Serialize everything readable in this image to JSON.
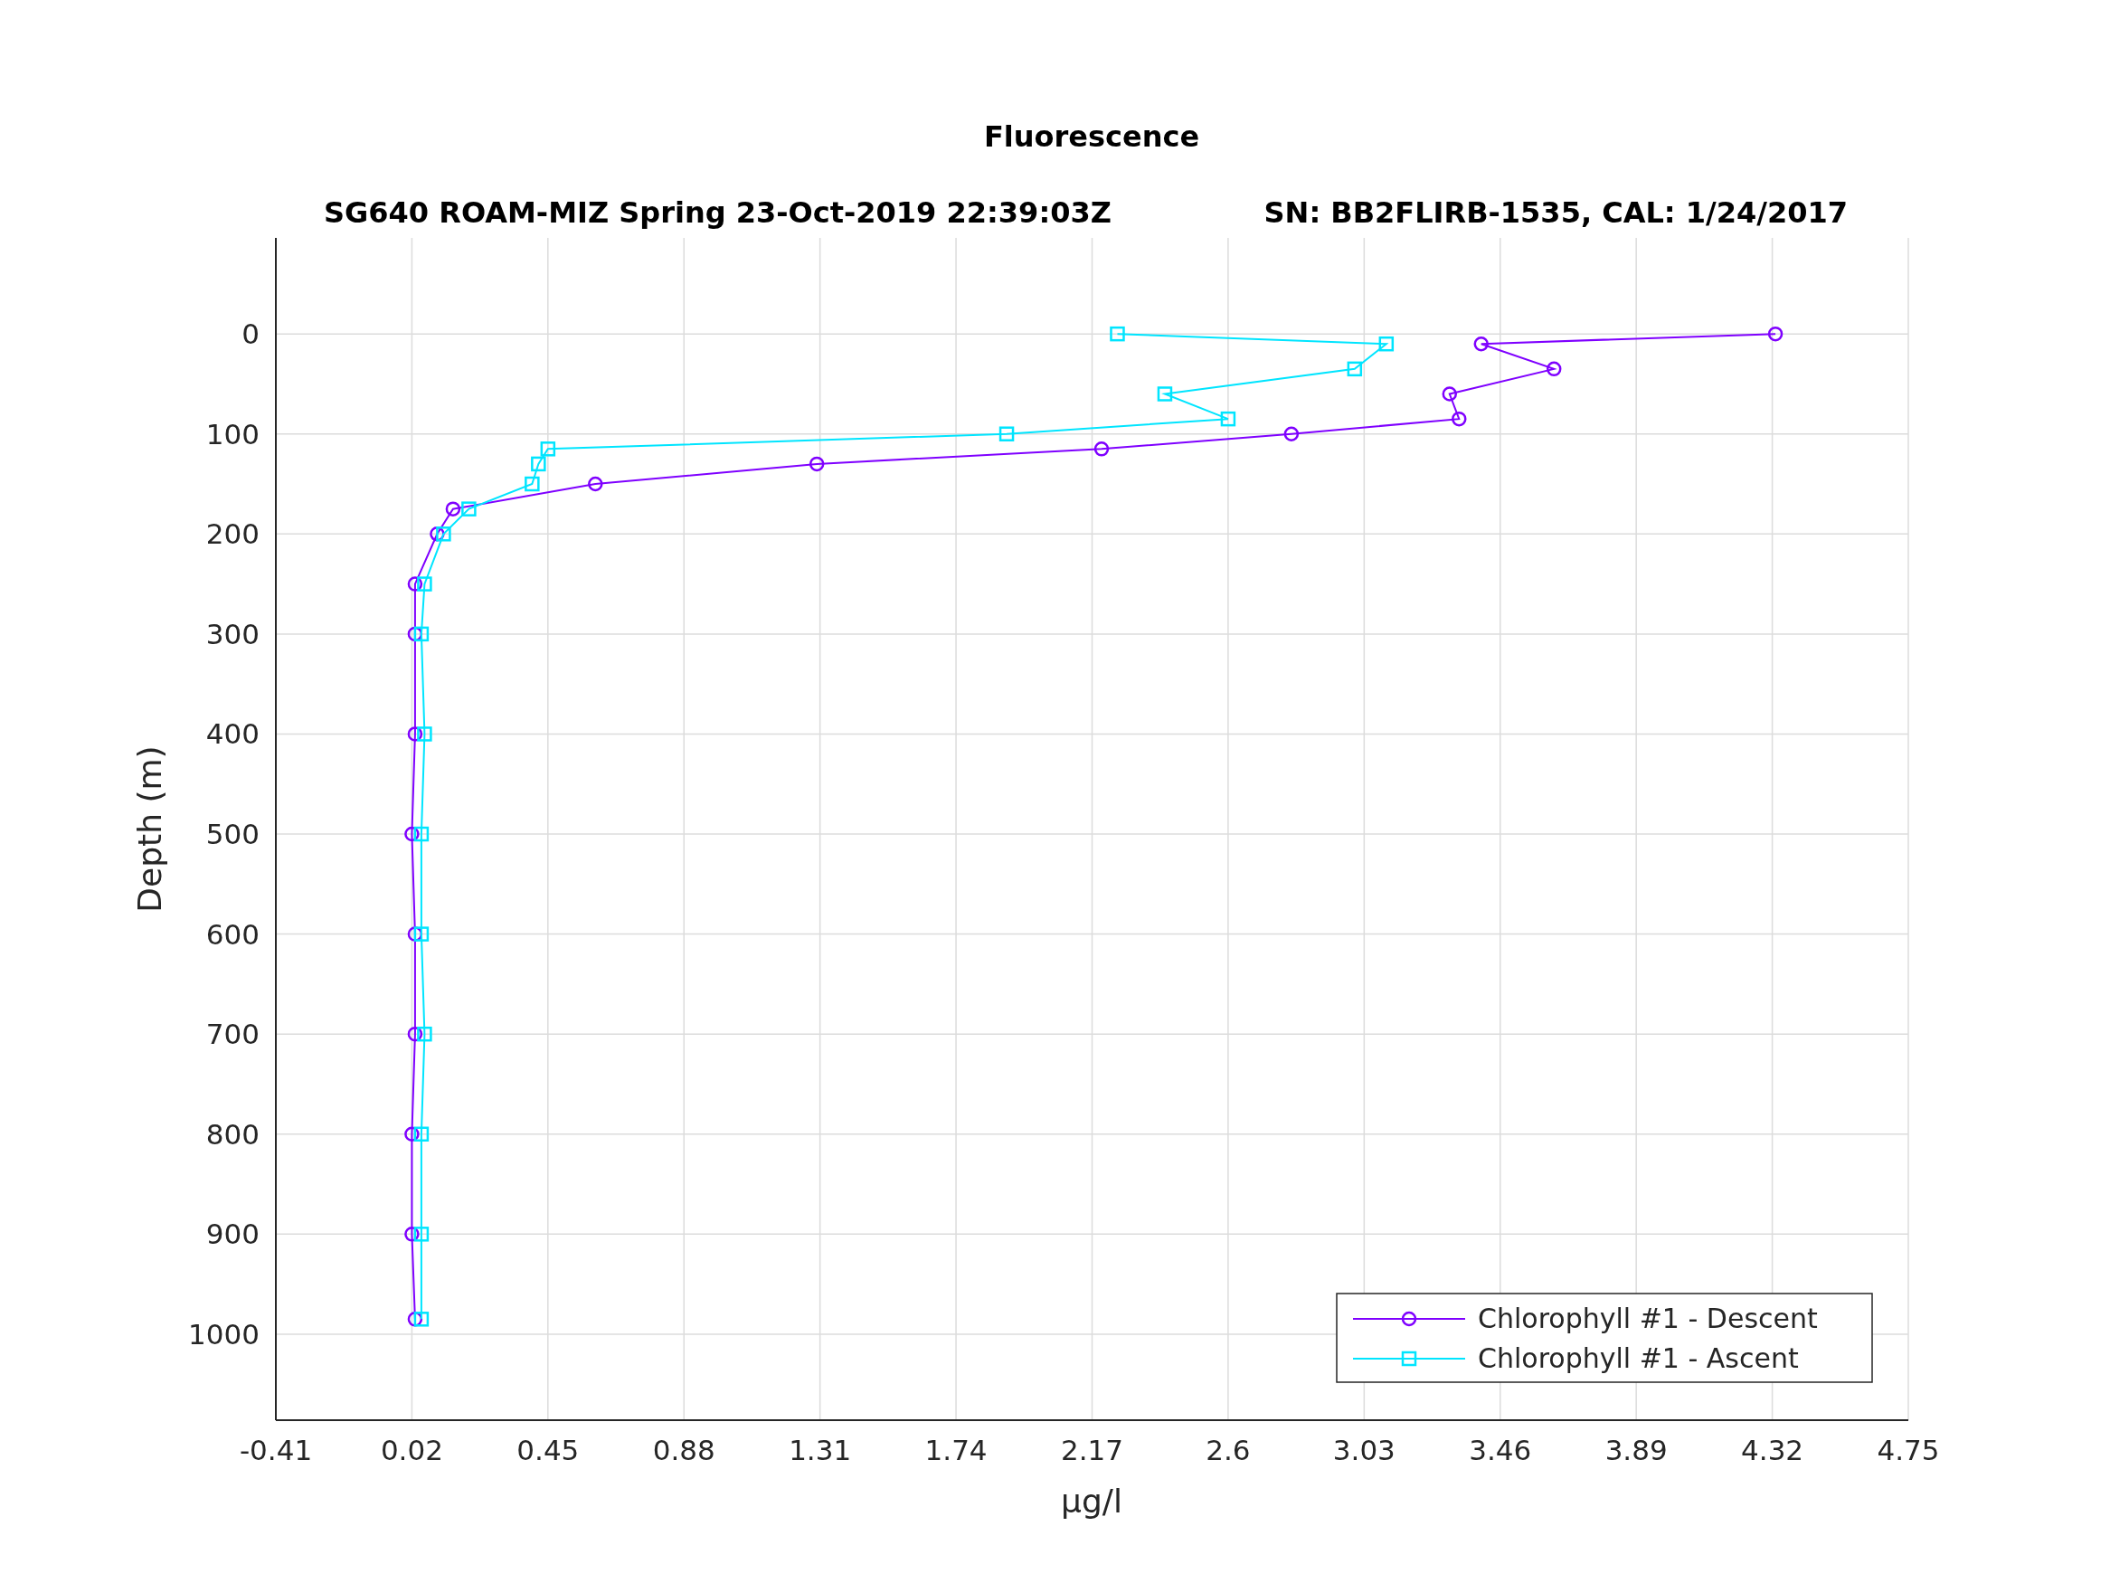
{
  "subtitle_left": "SG640 ROAM-MIZ Spring 23-Oct-2019 22:39:03Z",
  "subtitle_right": "SN: BB2FLIRB-1535, CAL: 1/24/2017",
  "chart_data": {
    "type": "line",
    "orientation": "horizontal",
    "title": "Fluorescence",
    "xlabel": "μg/l",
    "ylabel": "Depth (m)",
    "x": [
      0,
      10,
      35,
      60,
      85,
      100,
      115,
      130,
      150,
      175,
      200,
      250,
      300,
      400,
      500,
      600,
      700,
      800,
      900,
      985
    ],
    "series": [
      {
        "name": "Chlorophyll #1 - Descent",
        "color": "#7f00ff",
        "marker": "circle",
        "values": [
          4.33,
          3.4,
          3.63,
          3.3,
          3.33,
          2.8,
          2.2,
          1.3,
          0.6,
          0.15,
          0.1,
          0.03,
          0.03,
          0.03,
          0.02,
          0.03,
          0.03,
          0.02,
          0.02,
          0.03
        ]
      },
      {
        "name": "Chlorophyll #1 - Ascent",
        "color": "#00e5ff",
        "marker": "square",
        "values": [
          2.25,
          3.1,
          3.0,
          2.4,
          2.6,
          1.9,
          0.45,
          0.42,
          0.4,
          0.2,
          0.12,
          0.06,
          0.05,
          0.06,
          0.05,
          0.05,
          0.06,
          0.05,
          0.05,
          0.05
        ]
      }
    ],
    "xlim": [
      -0.41,
      4.75
    ],
    "ylim": [
      1086,
      -96
    ],
    "xticks": [
      -0.41,
      0.02,
      0.45,
      0.88,
      1.31,
      1.74,
      2.17,
      2.6,
      3.03,
      3.46,
      3.89,
      4.32,
      4.75
    ],
    "yticks": [
      0,
      100,
      200,
      300,
      400,
      500,
      600,
      700,
      800,
      900,
      1000
    ],
    "grid": true,
    "legend": true
  }
}
